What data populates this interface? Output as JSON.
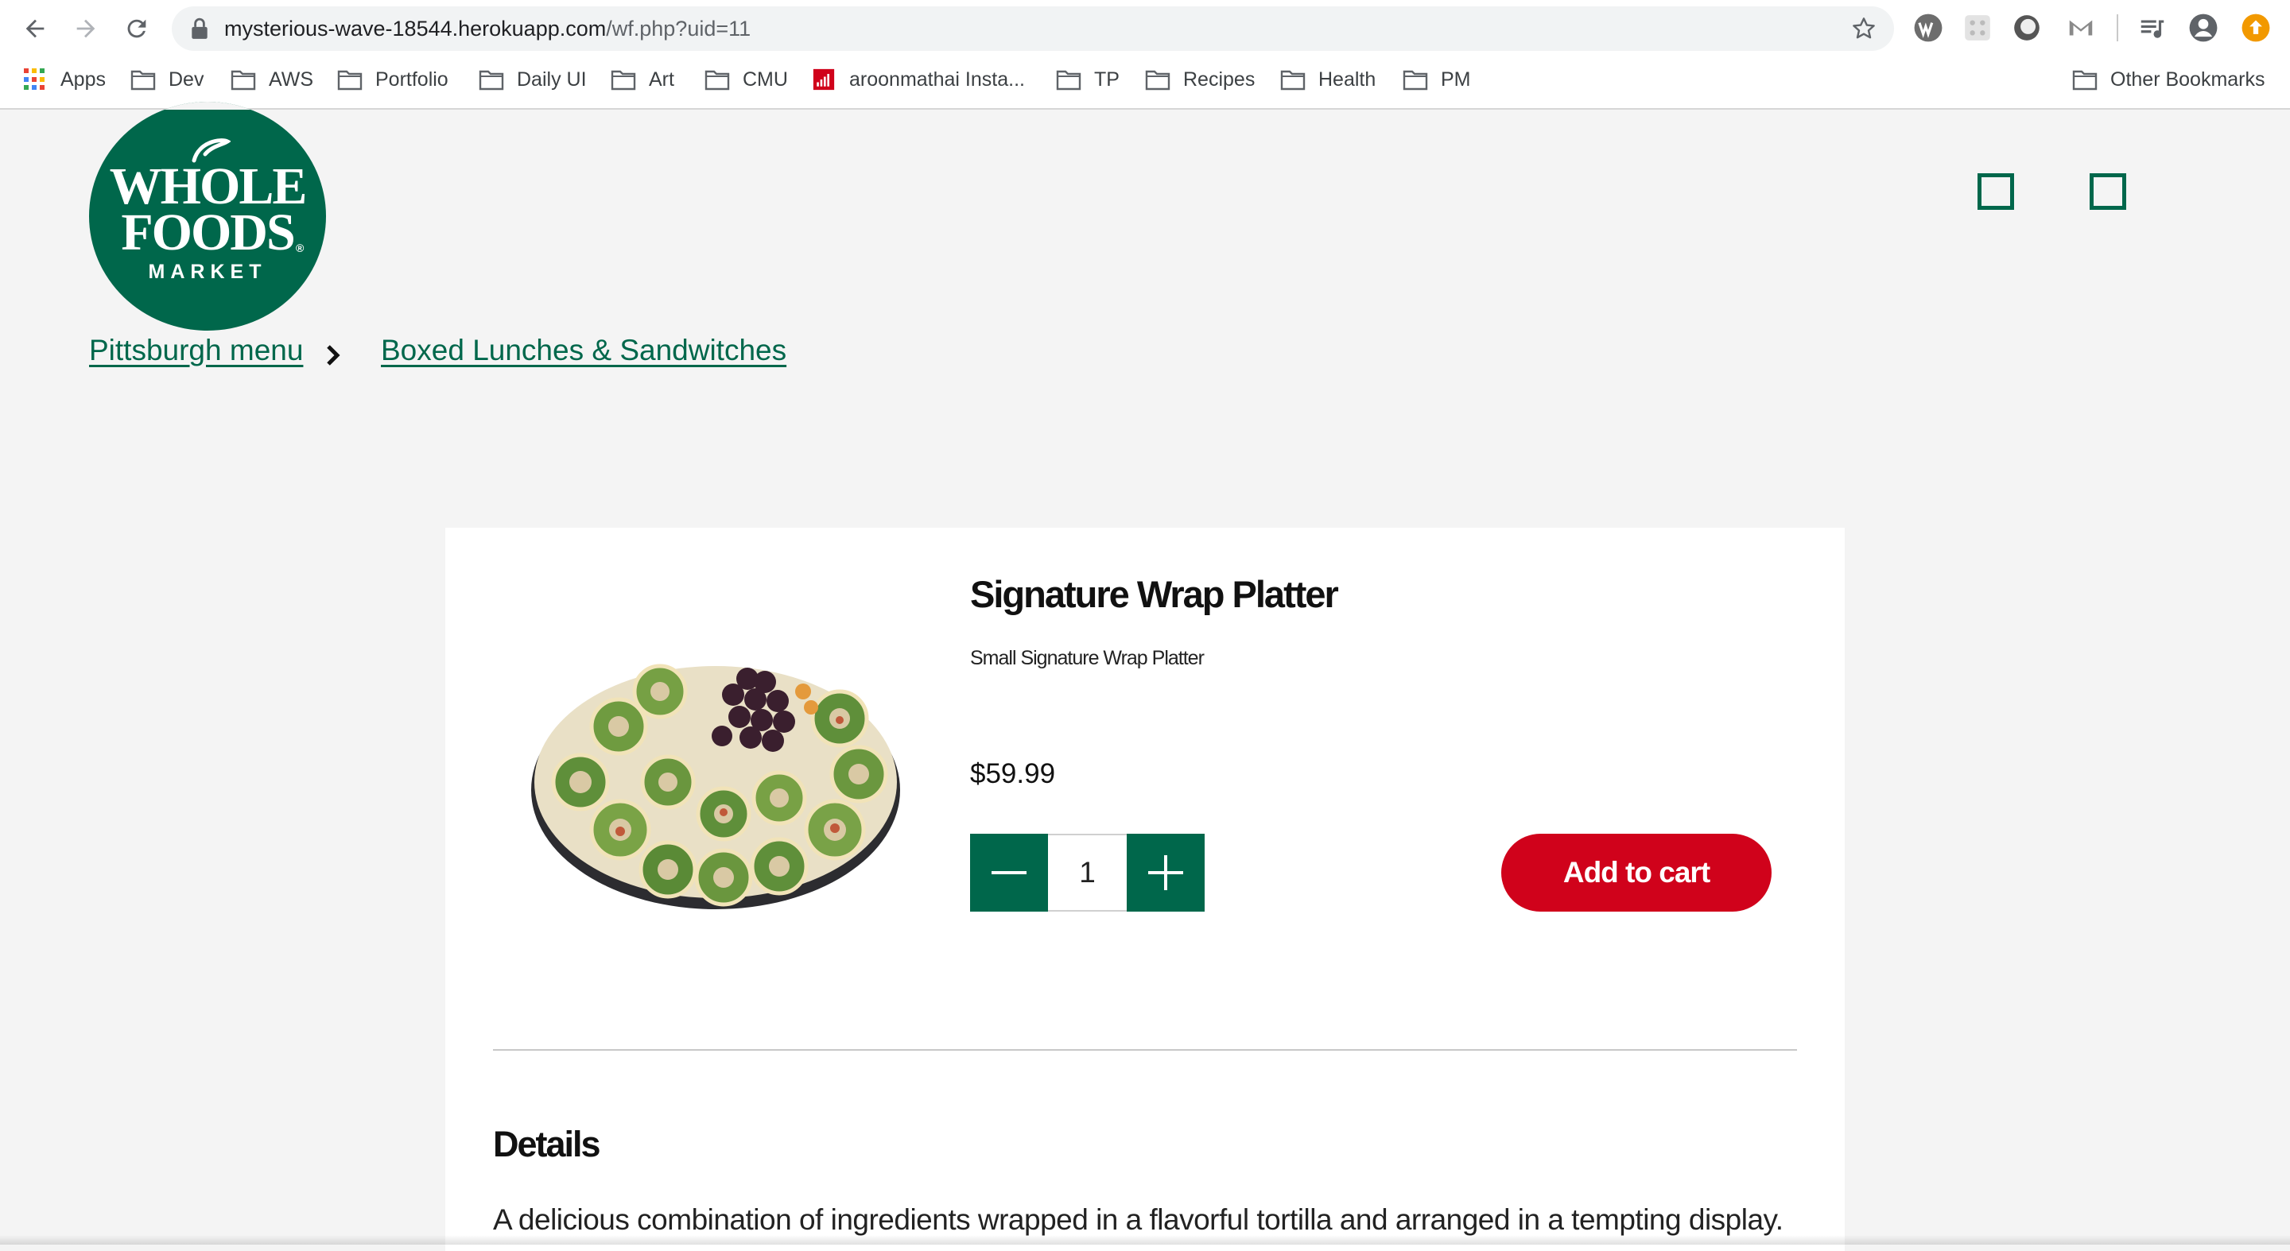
{
  "browser": {
    "url_host": "mysterious-wave-18544.herokuapp.com",
    "url_path": "/wf.php?uid=11",
    "bookmarks": [
      {
        "label": "Apps",
        "icon": "apps-grid-icon"
      },
      {
        "label": "Dev",
        "icon": "folder-icon"
      },
      {
        "label": "AWS",
        "icon": "folder-icon"
      },
      {
        "label": "Portfolio",
        "icon": "folder-icon"
      },
      {
        "label": "Daily UI",
        "icon": "folder-icon"
      },
      {
        "label": "Art",
        "icon": "folder-icon"
      },
      {
        "label": "CMU",
        "icon": "folder-icon"
      },
      {
        "label": "aroonmathai Insta...",
        "icon": "bar-chart-favicon"
      },
      {
        "label": "TP",
        "icon": "folder-icon"
      },
      {
        "label": "Recipes",
        "icon": "folder-icon"
      },
      {
        "label": "Health",
        "icon": "folder-icon"
      },
      {
        "label": "PM",
        "icon": "folder-icon"
      }
    ],
    "other_bookmarks": "Other Bookmarks"
  },
  "brand": {
    "logo_line1": "WHOLE",
    "logo_line2": "FOODS",
    "logo_line3": "MARKET",
    "logo_mark": "®",
    "color": "#00674b"
  },
  "breadcrumb": {
    "items": [
      "Pittsburgh menu",
      "Boxed Lunches & Sandwitches"
    ]
  },
  "product": {
    "title": "Signature Wrap Platter",
    "subtitle": "Small Signature Wrap Platter",
    "price": "$59.99",
    "quantity": "1",
    "add_to_cart": "Add to cart",
    "details_heading": "Details",
    "details_text": "A delicious combination of ingredients wrapped in a flavorful tortilla and arranged in a tempting display.",
    "cart_color": "#d0021b"
  }
}
